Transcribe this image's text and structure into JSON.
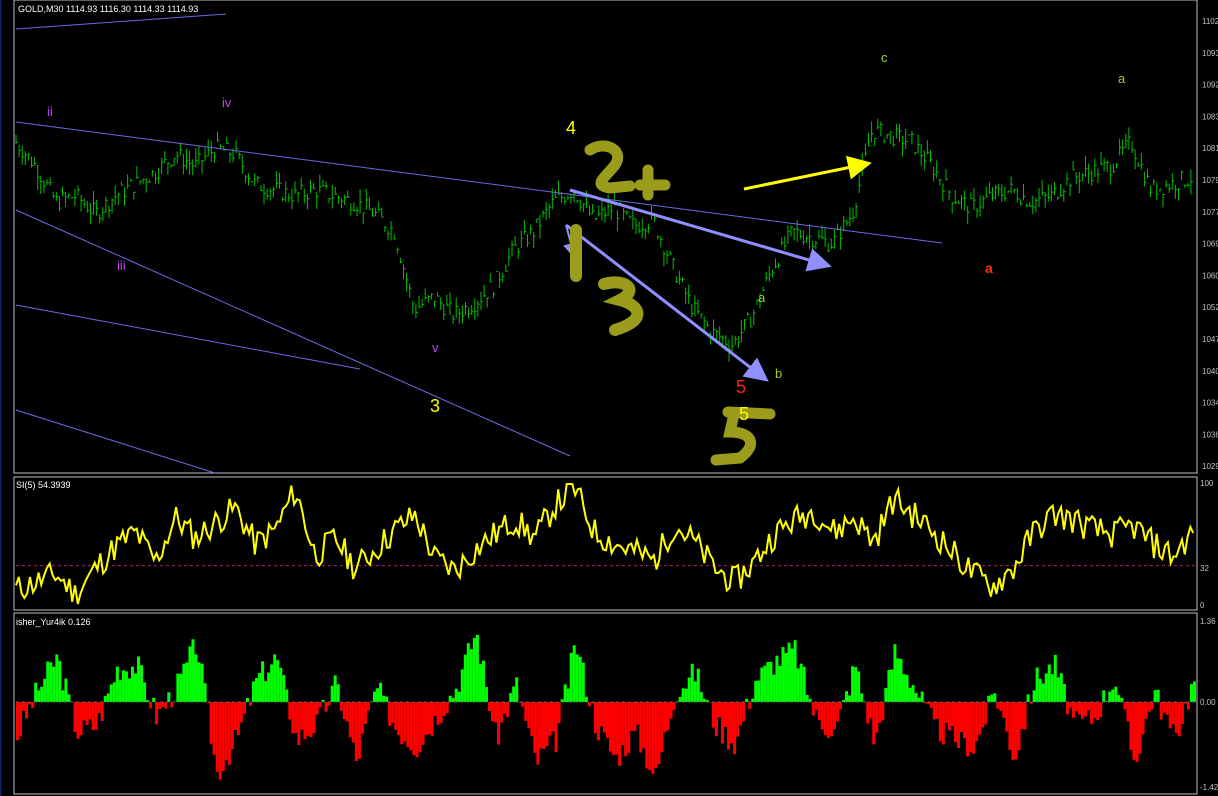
{
  "main_panel": {
    "header": "GOLD,M30  1114.93 1116.30 1114.33 1114.93",
    "price_axis": [
      "1102",
      "1093",
      "1092",
      "1083",
      "1081",
      "1079",
      "1077",
      "1069",
      "1060",
      "1052",
      "1047",
      "1040",
      "1034",
      "1036",
      "1029"
    ],
    "wave_labels": [
      {
        "text": "ii",
        "color": "#c040ff"
      },
      {
        "text": "iv",
        "color": "#c040ff"
      },
      {
        "text": "iii",
        "color": "#c040ff"
      },
      {
        "text": "v",
        "color": "#c040ff"
      },
      {
        "text": "3",
        "color": "#ffff00"
      },
      {
        "text": "4",
        "color": "#ffff00"
      },
      {
        "text": "5",
        "color": "#ff2020"
      },
      {
        "text": "5",
        "color": "#ffff00"
      },
      {
        "text": "a",
        "color": "#9acd32"
      },
      {
        "text": "b",
        "color": "#9acd32"
      },
      {
        "text": "c",
        "color": "#9acd32"
      },
      {
        "text": "a",
        "color": "#9acd32"
      },
      {
        "text": "a",
        "color": "#ff3010"
      }
    ]
  },
  "si_panel": {
    "header": "SI(5) 54.3939",
    "axis": [
      "100",
      "32",
      "0"
    ]
  },
  "fisher_panel": {
    "header": "isher_Yur4ik 0.126",
    "axis": [
      "1.36",
      "0.00",
      "-1.42"
    ]
  },
  "colors": {
    "background": "#000000",
    "price_bars": "#00c000",
    "trendlines": "#6a6ae6",
    "si_line": "#ffff00",
    "fisher_positive": "#00ff00",
    "fisher_negative": "#ff0000",
    "annotation_arrow": "#ffff00",
    "blue_arrows": "#8f8fff",
    "scribble": "#9b9b1c"
  },
  "chart_data": [
    {
      "type": "ohlc",
      "series": [
        {
          "name": "GOLD,M30",
          "x": [
            0,
            20,
            40,
            60,
            80,
            100,
            120,
            140,
            160,
            180,
            200,
            220,
            240,
            260,
            280,
            300,
            320,
            340,
            360,
            380,
            400,
            420,
            440,
            460,
            480,
            500,
            520,
            540,
            560,
            580,
            600,
            620,
            640,
            660,
            680,
            700,
            720,
            740,
            760,
            780,
            800,
            820,
            840,
            860,
            880,
            900,
            920,
            940,
            960,
            980,
            1000,
            1020,
            1040,
            1060,
            1080,
            1100,
            1120,
            1140,
            1160,
            1180
          ],
          "close": [
            1081,
            1077,
            1071,
            1072,
            1069,
            1072,
            1074,
            1076,
            1079,
            1077,
            1080,
            1079,
            1074,
            1073,
            1072,
            1073,
            1072,
            1071,
            1069,
            1066,
            1053,
            1055,
            1052,
            1054,
            1057,
            1063,
            1066,
            1071,
            1073,
            1068,
            1070,
            1067,
            1068,
            1060,
            1053,
            1049,
            1047,
            1052,
            1060,
            1066,
            1065,
            1064,
            1069,
            1083,
            1082,
            1081,
            1077,
            1072,
            1070,
            1072,
            1073,
            1071,
            1072,
            1075,
            1076,
            1077,
            1081,
            1073,
            1074,
            1075
          ]
        }
      ]
    },
    {
      "type": "line",
      "series": [
        {
          "name": "SI(5)",
          "values": [
            12,
            18,
            25,
            8,
            30,
            48,
            60,
            35,
            72,
            55,
            68,
            80,
            50,
            62,
            95,
            40,
            55,
            30,
            45,
            62,
            74,
            38,
            28,
            45,
            58,
            70,
            55,
            82,
            96,
            60,
            50,
            44,
            36,
            66,
            52,
            30,
            18,
            35,
            58,
            70,
            78,
            60,
            72,
            52,
            88,
            74,
            60,
            42,
            25,
            15,
            30,
            60,
            75,
            70,
            62,
            58,
            65,
            50,
            40,
            60
          ]
        }
      ],
      "ylim": [
        0,
        100
      ]
    },
    {
      "type": "bar",
      "series": [
        {
          "name": "Fisher_Yur4ik",
          "values": [
            -0.45,
            0.15,
            0.6,
            -0.4,
            -0.3,
            0.45,
            0.5,
            -0.2,
            0.2,
            0.8,
            -0.95,
            -0.5,
            0.3,
            0.6,
            -0.5,
            -0.3,
            0.25,
            -0.8,
            0.2,
            -0.35,
            -0.6,
            -0.2,
            0.2,
            0.95,
            -0.5,
            0.25,
            -0.8,
            -0.5,
            0.8,
            -0.3,
            -0.75,
            -0.4,
            -1.0,
            0.15,
            0.4,
            -0.3,
            -0.55,
            0.3,
            0.55,
            0.7,
            -0.2,
            -0.4,
            0.5,
            -0.55,
            0.7,
            0.2,
            -0.35,
            -0.5,
            -0.6,
            0.15,
            -0.75,
            0.3,
            0.5,
            -0.3,
            -0.2,
            0.35,
            -0.8,
            0.15,
            -0.5,
            0.3
          ]
        }
      ],
      "ylim": [
        -1.42,
        1.36
      ]
    }
  ]
}
